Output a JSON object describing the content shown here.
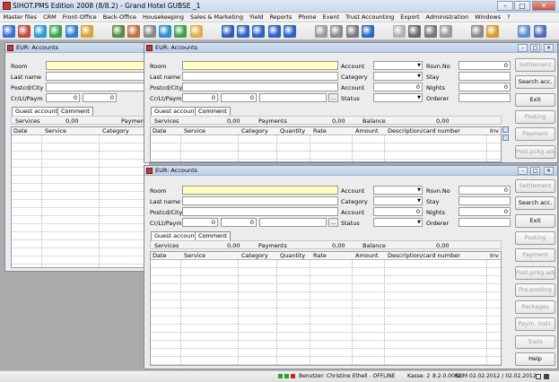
{
  "app": {
    "title": "SIHOT.PMS Edition 2008 (8/8.2) - Grand Hotel GUBSE _1",
    "controls": {
      "minimize": "–",
      "maximize": "□",
      "close": "✕"
    }
  },
  "menu": [
    "Master files",
    "CRM",
    "Front-Office",
    "Back-Office",
    "Housekeeping",
    "Sales & Marketing",
    "Yield",
    "Reports",
    "Phone",
    "Event",
    "Trust Accounting",
    "Export",
    "Administration",
    "Windows",
    "?"
  ],
  "toolbar_icons": [
    {
      "name": "calendar-icon",
      "color": "#3b6fd1"
    },
    {
      "name": "grid-icon",
      "color": "#c6493a"
    },
    {
      "name": "globe-icon",
      "color": "#2d9ad8"
    },
    {
      "name": "chart-icon",
      "color": "#3aa548"
    },
    {
      "name": "screen-icon",
      "color": "#2e7fd6"
    },
    {
      "name": "keys-icon",
      "color": "#d8a62e"
    },
    {
      "name": "people-icon",
      "color": "#5a8a3a"
    },
    {
      "name": "group-icon",
      "color": "#c2703b"
    },
    {
      "name": "card-icon",
      "color": "#888888"
    },
    {
      "name": "globe-2-icon",
      "color": "#2a8fd0"
    },
    {
      "name": "earth-icon",
      "color": "#3ba050"
    },
    {
      "name": "folder-icon",
      "color": "#e0b040"
    },
    {
      "name": "save-icon",
      "color": "#2d5fb8"
    },
    {
      "name": "first-icon",
      "color": "#2a62c8"
    },
    {
      "name": "prev-icon",
      "color": "#2a62c8"
    },
    {
      "name": "back-icon",
      "color": "#2a62c8"
    },
    {
      "name": "next-icon",
      "color": "#2a62c8"
    },
    {
      "name": "doc-icon",
      "color": "#9a9a9a"
    },
    {
      "name": "copy-icon",
      "color": "#8a8a8a"
    },
    {
      "name": "print-icon",
      "color": "#7a7a7a"
    },
    {
      "name": "disk-icon",
      "color": "#2b68c0"
    },
    {
      "name": "delete-icon",
      "color": "#b0b0b0"
    },
    {
      "name": "filter-icon",
      "color": "#6a6a6a"
    },
    {
      "name": "search-icon",
      "color": "#777777"
    },
    {
      "name": "stop-icon",
      "color": "#999999"
    },
    {
      "name": "help-icon",
      "color": "#8a8a8a"
    },
    {
      "name": "window-icon",
      "color": "#d89a2a"
    },
    {
      "name": "window-2-icon",
      "color": "#5a90d0"
    },
    {
      "name": "user-icon",
      "color": "#4a70b8"
    }
  ],
  "windows": [
    {
      "title": "EUR: Accounts",
      "labels": {
        "room": "Room",
        "last_name": "Last name",
        "postcd": "Postcd/City",
        "cr": "Cr/Lt/Paym"
      },
      "cr_values": [
        "0",
        "0"
      ],
      "tabs": [
        "Guest account",
        "Comment"
      ],
      "summary": {
        "services_label": "Services",
        "services_value": "0,00",
        "payments_label": "Paymen"
      },
      "columns": [
        "Date",
        "Service",
        "Category"
      ]
    },
    {
      "title": "EUR: Accounts",
      "labels": {
        "room": "Room",
        "last_name": "Last name",
        "postcd": "Postcd/City",
        "cr": "Cr/Lt/Paym",
        "account": "Account",
        "category": "Category",
        "account2": "Account",
        "status": "Status",
        "rsvn": "Rsvn.No",
        "stay": "Stay",
        "nights": "Nights",
        "orderer": "Orderer"
      },
      "values": {
        "cr1": "0",
        "cr2": "0",
        "account2": "0",
        "rsvn": "0",
        "nights": "0"
      },
      "tabs": [
        "Guest account",
        "Comment"
      ],
      "summary": {
        "services_label": "Services",
        "services_value": "0,00",
        "payments_label": "Payments",
        "payments_value": "0,00",
        "balance_label": "Balance",
        "balance_value": "0,00"
      },
      "columns": [
        "Date",
        "Service",
        "Category",
        "Quantity",
        "Rate",
        "Amount",
        "Description/card number",
        "Inv"
      ],
      "ellipsis": "...",
      "buttons": [
        {
          "label": "Settlement",
          "disabled": true
        },
        {
          "label": "Search acc.",
          "disabled": false
        },
        {
          "label": "Exit",
          "disabled": false
        },
        {
          "label": "Posting",
          "disabled": true
        },
        {
          "label": "Payment",
          "disabled": true
        },
        {
          "label": "Post.pckg.adv.",
          "disabled": true
        }
      ]
    },
    {
      "title": "EUR: Accounts",
      "labels": {
        "room": "Room",
        "last_name": "Last name",
        "postcd": "Postcd/City",
        "cr": "Cr/Lt/Paym",
        "account": "Account",
        "category": "Category",
        "account2": "Account",
        "status": "Status",
        "rsvn": "Rsvn.No",
        "stay": "Stay",
        "nights": "Nights",
        "orderer": "Orderer"
      },
      "values": {
        "cr1": "0",
        "cr2": "0",
        "account2": "0",
        "rsvn": "0",
        "nights": "0"
      },
      "tabs": [
        "Guest account",
        "Comment"
      ],
      "summary": {
        "services_label": "Services",
        "services_value": "0,00",
        "payments_label": "Payments",
        "payments_value": "0,00",
        "balance_label": "Balance",
        "balance_value": "0,00"
      },
      "columns": [
        "Date",
        "Service",
        "Category",
        "Quantity",
        "Rate",
        "Amount",
        "Description/card number",
        "Inv"
      ],
      "ellipsis": "...",
      "buttons": [
        {
          "label": "Settlement",
          "disabled": true
        },
        {
          "label": "Search acc.",
          "disabled": false
        },
        {
          "label": "Exit",
          "disabled": false
        },
        {
          "label": "Posting",
          "disabled": true
        },
        {
          "label": "Payment",
          "disabled": true
        },
        {
          "label": "Post.pckg.adv.",
          "disabled": true
        },
        {
          "label": "Pre-posting",
          "disabled": true
        },
        {
          "label": "Packages",
          "disabled": true
        },
        {
          "label": "Paym. instr.",
          "disabled": true
        },
        {
          "label": "Trails",
          "disabled": true
        },
        {
          "label": "Help",
          "disabled": false
        }
      ]
    }
  ],
  "status": {
    "user": "Benutzer: Christine Ethell - OFFLINE",
    "kasse": "Kasse: 2",
    "version": "8.2.0.0062",
    "num": "NUM",
    "dates": "02.02.2012 / 02.02.2012",
    "colors": [
      "#2aa32a",
      "#2aa32a",
      "#d02020"
    ]
  }
}
